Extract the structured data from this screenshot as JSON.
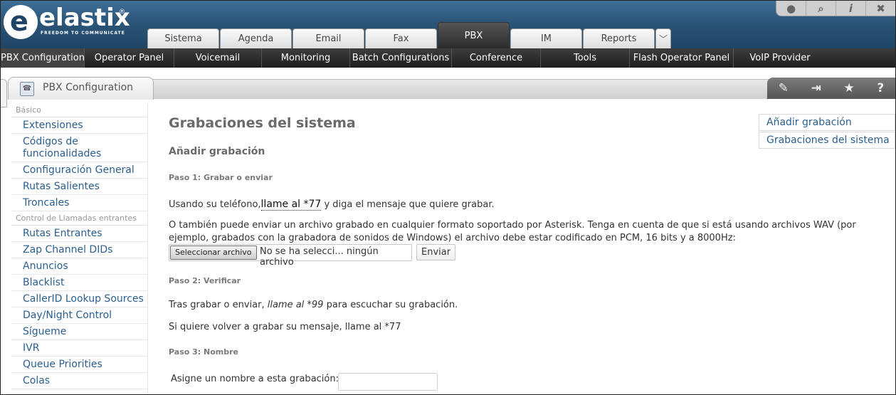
{
  "brand": {
    "logo_mark": "e",
    "name": "elastix",
    "reg": "®",
    "tagline": "FREEDOM TO COMMUNICATE"
  },
  "top_icons": [
    "drop-icon",
    "search-icon",
    "info-icon",
    "settings-icon"
  ],
  "tabs": [
    {
      "label": "Sistema",
      "active": false
    },
    {
      "label": "Agenda",
      "active": false
    },
    {
      "label": "Email",
      "active": false
    },
    {
      "label": "Fax",
      "active": false
    },
    {
      "label": "PBX",
      "active": true
    },
    {
      "label": "IM",
      "active": false
    },
    {
      "label": "Reports",
      "active": false
    }
  ],
  "subnav": [
    {
      "label": "PBX Configuration",
      "active": true
    },
    {
      "label": "Operator Panel",
      "active": false
    },
    {
      "label": "Voicemail",
      "active": false
    },
    {
      "label": "Monitoring",
      "active": false
    },
    {
      "label": "Batch Configurations",
      "active": false
    },
    {
      "label": "Conference",
      "active": false
    },
    {
      "label": "Tools",
      "active": false
    },
    {
      "label": "Flash Operator Panel",
      "active": false
    },
    {
      "label": "VoIP Provider",
      "active": false
    }
  ],
  "module": {
    "title": "PBX Configuration"
  },
  "sidebar": {
    "groups": [
      {
        "heading": "Básico",
        "items": [
          "Extensiones",
          "Códigos de funcionalidades",
          "Configuración General",
          "Rutas Salientes",
          "Troncales"
        ]
      },
      {
        "heading": "Control de Llamadas entrantes",
        "items": [
          "Rutas Entrantes",
          "Zap Channel DIDs",
          "Anuncios",
          "Blacklist",
          "CallerID Lookup Sources",
          "Day/Night Control",
          "Sígueme",
          "IVR",
          "Queue Priorities",
          "Colas"
        ]
      }
    ]
  },
  "right_links": [
    "Añadir grabación",
    "Grabaciones del sistema"
  ],
  "main": {
    "page_title": "Grabaciones del sistema",
    "section_title": "Añadir grabación",
    "step1": "Paso 1: Grabar o enviar",
    "step1_text_a": "Usando su teléfono,",
    "step1_text_b": "llame al *77",
    "step1_text_c": " y diga el mensaje que quiere grabar.",
    "upload_text": "O también puede enviar un archivo grabado en cualquier formato soportado por Asterisk. Tenga en cuenta de que si está usando archivos WAV (por ejemplo, grabados con la grabadora de sonidos de Windows) el archivo debe estar codificado en PCM, 16 bits y a 8000Hz:",
    "file_button": "Seleccionar archivo",
    "file_status": "No se ha selecci... ningún archivo",
    "send_button": "Enviar",
    "step2": "Paso 2: Verificar",
    "step2_text_a": "Tras grabar o enviar, ",
    "step2_text_b": "llame al *99",
    "step2_text_c": " para escuchar su grabación.",
    "step2_rerecord": "Si quiere volver a grabar su mensaje, llame al *77",
    "step3": "Paso 3: Nombre",
    "name_label": "Asigne un nombre a esta grabación:",
    "name_value": ""
  }
}
